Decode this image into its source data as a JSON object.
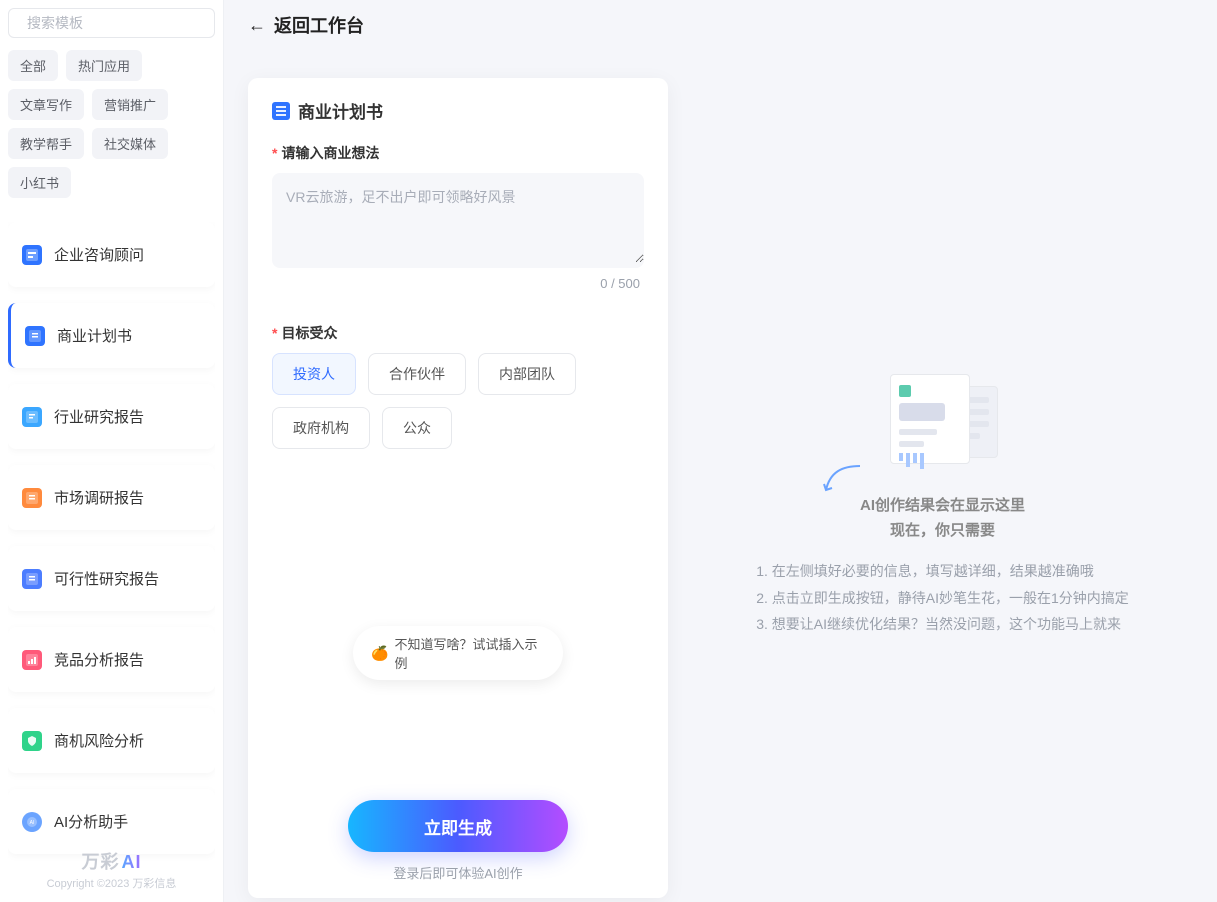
{
  "sidebar": {
    "search_placeholder": "搜索模板",
    "tags": [
      "全部",
      "热门应用",
      "文章写作",
      "营销推广",
      "教学帮手",
      "社交媒体",
      "小红书"
    ],
    "nav": [
      {
        "label": "企业咨询顾问",
        "color": "#2f74ff"
      },
      {
        "label": "商业计划书",
        "color": "#2f74ff",
        "active": true
      },
      {
        "label": "行业研究报告",
        "color": "#3ba7ff"
      },
      {
        "label": "市场调研报告",
        "color": "#ff8a3d"
      },
      {
        "label": "可行性研究报告",
        "color": "#4c7dff"
      },
      {
        "label": "竞品分析报告",
        "color": "#ff5a7a"
      },
      {
        "label": "商机风险分析",
        "color": "#2fd38a"
      },
      {
        "label": "AI分析助手",
        "color": "#6ba4ff"
      }
    ],
    "brand_prefix": "万彩",
    "brand_suffix": "AI",
    "copyright": "Copyright ©2023 万彩信息"
  },
  "header": {
    "back_label": "返回工作台"
  },
  "form": {
    "title": "商业计划书",
    "idea_label": "请输入商业想法",
    "idea_placeholder": "VR云旅游，足不出户即可领略好风景",
    "idea_counter": "0 / 500",
    "audience_label": "目标受众",
    "audience_options": [
      {
        "label": "投资人",
        "selected": true
      },
      {
        "label": "合作伙伴",
        "selected": false
      },
      {
        "label": "内部团队",
        "selected": false
      },
      {
        "label": "政府机构",
        "selected": false
      },
      {
        "label": "公众",
        "selected": false
      }
    ],
    "hint_text": "不知道写啥？试试插入示例",
    "generate_btn": "立即生成",
    "login_hint": "登录后即可体验AI创作"
  },
  "result": {
    "title": "AI创作结果会在显示这里",
    "subtitle": "现在，你只需要",
    "steps": [
      "1. 在左侧填好必要的信息，填写越详细，结果越准确哦",
      "2. 点击立即生成按钮，静待AI妙笔生花，一般在1分钟内搞定",
      "3. 想要让AI继续优化结果？当然没问题，这个功能马上就来"
    ]
  }
}
